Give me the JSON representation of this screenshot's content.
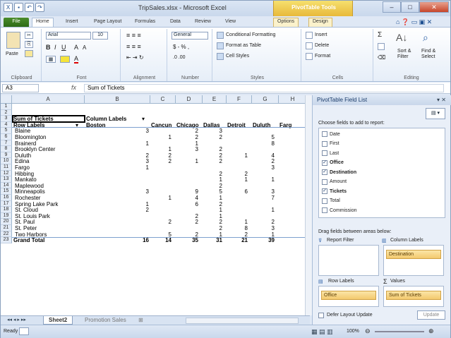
{
  "window": {
    "title": "TripSales.xlsx - Microsoft Excel",
    "context_tab_group": "PivotTable Tools",
    "controls": [
      "–",
      "□",
      "✕"
    ]
  },
  "ribbon_tabs": [
    "File",
    "Home",
    "Insert",
    "Page Layout",
    "Formulas",
    "Data",
    "Review",
    "View",
    "Options",
    "Design"
  ],
  "ribbon": {
    "clipboard": {
      "paste": "Paste",
      "label": "Clipboard"
    },
    "font": {
      "name": "Arial",
      "size": "10",
      "label": "Font"
    },
    "alignment": {
      "label": "Alignment"
    },
    "number": {
      "format": "General",
      "label": "Number"
    },
    "styles": {
      "conditional": "Conditional Formatting",
      "format_table": "Format as Table",
      "cell_styles": "Cell Styles",
      "label": "Styles"
    },
    "cells": {
      "insert": "Insert",
      "delete": "Delete",
      "format": "Format",
      "label": "Cells"
    },
    "editing": {
      "sort": "Sort & Filter",
      "find": "Find & Select",
      "label": "Editing"
    }
  },
  "formula_bar": {
    "name_box": "A3",
    "fx": "fx",
    "value": "Sum of Tickets"
  },
  "columns": [
    "A",
    "B",
    "C",
    "D",
    "E",
    "F",
    "G",
    "H"
  ],
  "pivot": {
    "corner": "Sum of Tickets",
    "col_labels": "Column Labels",
    "row_labels": "Row Labels",
    "headers": [
      "Boston",
      "Cancun",
      "Chicago",
      "Dallas",
      "Detroit",
      "Duluth",
      "Farg"
    ],
    "rows": [
      {
        "name": "Blaine",
        "v": [
          "3",
          "",
          "2",
          "3",
          "",
          ""
        ]
      },
      {
        "name": "Bloomington",
        "v": [
          "",
          "1",
          "2",
          "2",
          "",
          "5"
        ]
      },
      {
        "name": "Brainerd",
        "v": [
          "1",
          "",
          "1",
          "",
          "",
          "8"
        ]
      },
      {
        "name": "Brooklyn Center",
        "v": [
          "",
          "1",
          "3",
          "2",
          "",
          ""
        ]
      },
      {
        "name": "Duluth",
        "v": [
          "2",
          "2",
          "",
          "2",
          "1",
          "4"
        ]
      },
      {
        "name": "Edina",
        "v": [
          "3",
          "2",
          "1",
          "2",
          "",
          "2"
        ]
      },
      {
        "name": "Fargo",
        "v": [
          "1",
          "",
          "",
          "",
          "",
          "3"
        ]
      },
      {
        "name": "Hibbing",
        "v": [
          "",
          "",
          "",
          "2",
          "2",
          ""
        ]
      },
      {
        "name": "Mankato",
        "v": [
          "",
          "",
          "",
          "1",
          "1",
          "1"
        ]
      },
      {
        "name": "Maplewood",
        "v": [
          "",
          "",
          "",
          "2",
          "",
          ""
        ]
      },
      {
        "name": "Minneapolis",
        "v": [
          "3",
          "",
          "9",
          "5",
          "6",
          "3"
        ]
      },
      {
        "name": "Rochester",
        "v": [
          "",
          "1",
          "4",
          "1",
          "",
          "7"
        ]
      },
      {
        "name": "Spring Lake Park",
        "v": [
          "1",
          "",
          "6",
          "2",
          "",
          ""
        ]
      },
      {
        "name": "St. Cloud",
        "v": [
          "2",
          "",
          "",
          "1",
          "",
          "1"
        ]
      },
      {
        "name": "St. Louis Park",
        "v": [
          "",
          "",
          "2",
          "1",
          "",
          ""
        ]
      },
      {
        "name": "St. Paul",
        "v": [
          "",
          "2",
          "2",
          "2",
          "1",
          "2"
        ]
      },
      {
        "name": "St. Peter",
        "v": [
          "",
          "",
          "",
          "2",
          "8",
          "3"
        ]
      },
      {
        "name": "Two Harbors",
        "v": [
          "",
          "5",
          "2",
          "1",
          "2",
          "1"
        ]
      }
    ],
    "total": {
      "name": "Grand Total",
      "v": [
        "16",
        "14",
        "35",
        "31",
        "21",
        "39"
      ]
    }
  },
  "sheet_tabs": [
    "Sheet2",
    "Promotion Sales"
  ],
  "status": {
    "ready": "Ready",
    "zoom": "100%"
  },
  "field_list": {
    "title": "PivotTable Field List",
    "choose": "Choose fields to add to report:",
    "fields": [
      {
        "name": "Date",
        "checked": false
      },
      {
        "name": "First",
        "checked": false
      },
      {
        "name": "Last",
        "checked": false
      },
      {
        "name": "Office",
        "checked": true
      },
      {
        "name": "Destination",
        "checked": true
      },
      {
        "name": "Amount",
        "checked": false
      },
      {
        "name": "Tickets",
        "checked": true
      },
      {
        "name": "Total",
        "checked": false
      },
      {
        "name": "Commission",
        "checked": false
      }
    ],
    "drag_text": "Drag fields between areas below:",
    "report_filter": "Report Filter",
    "column_labels": "Column Labels",
    "column_chip": "Destination",
    "row_labels": "Row Labels",
    "values": "Values",
    "row_chip": "Office",
    "values_chip": "Sum of Tickets",
    "defer": "Defer Layout Update",
    "update": "Update"
  }
}
